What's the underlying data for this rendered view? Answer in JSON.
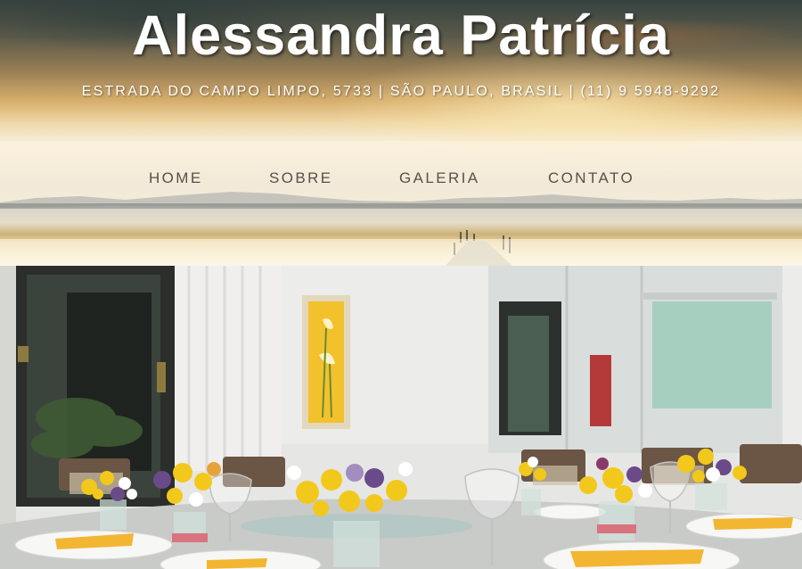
{
  "site": {
    "title": "Alessandra Patrícia",
    "info": "ESTRADA DO CAMPO LIMPO, 5733 | SÃO PAULO, BRASIL | (11) 9 5948-9292"
  },
  "nav": {
    "items": [
      {
        "label": "HOME"
      },
      {
        "label": "SOBRE"
      },
      {
        "label": "GALERIA"
      },
      {
        "label": "CONTATO"
      }
    ]
  },
  "colors": {
    "title_text": "#ffffff",
    "nav_text": "#55524b",
    "flower_yellow": "#f3c81c",
    "flower_purple": "#6b4a8a",
    "napkin_yellow": "#f2b632"
  },
  "icons": {
    "hero_image": "sunset-lake-pier-photo",
    "main_image": "dining-room-table-flowers-photo"
  }
}
